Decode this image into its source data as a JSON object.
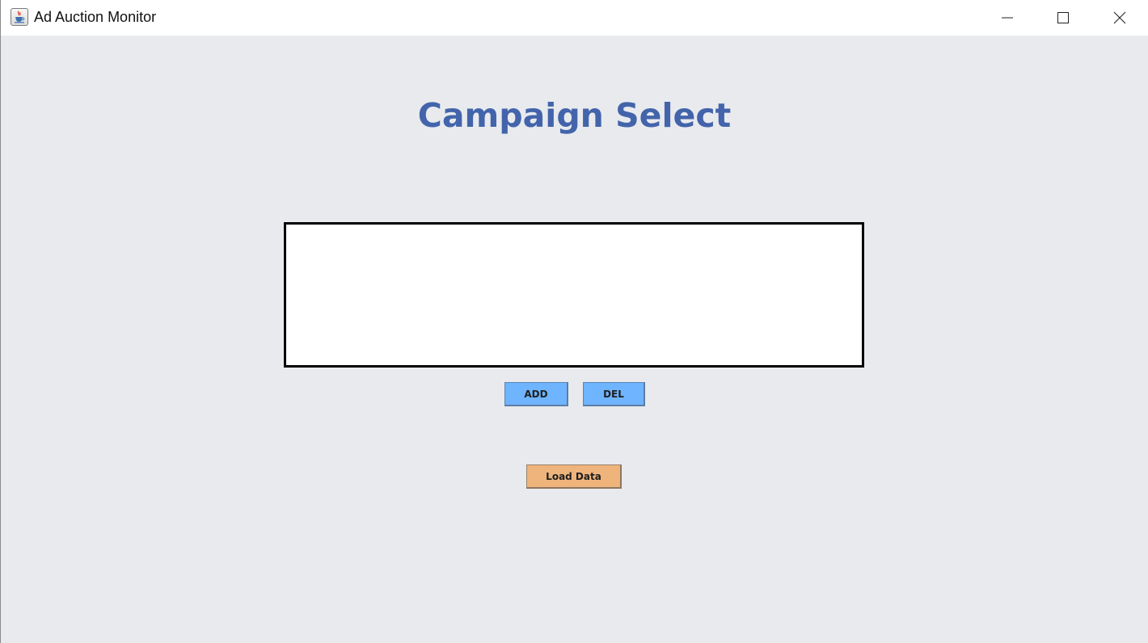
{
  "window": {
    "title": "Ad Auction Monitor",
    "icon": "java-cup-icon",
    "controls": [
      "minimize-icon",
      "maximize-icon",
      "close-icon"
    ]
  },
  "main": {
    "heading": "Campaign Select",
    "campaign_list": {
      "items": []
    },
    "buttons": {
      "add_label": "ADD",
      "del_label": "DEL",
      "load_label": "Load Data"
    }
  },
  "colors": {
    "background": "#e8eaee",
    "heading": "#4364ab",
    "add_del_button": "#6eb4ff",
    "load_button": "#efb47c",
    "list_border": "#000000"
  }
}
